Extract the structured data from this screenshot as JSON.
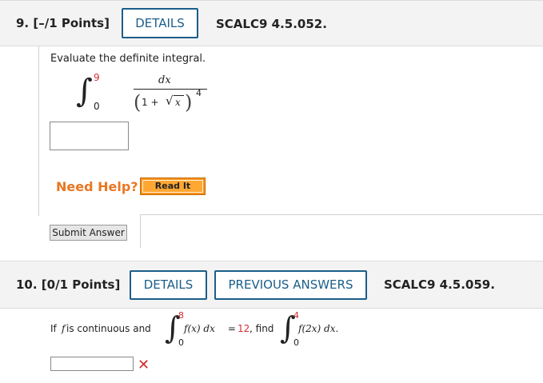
{
  "q9": {
    "points": "9.  [–/1 Points]",
    "details_label": "DETAILS",
    "code": "SCALC9 4.5.052.",
    "prompt": "Evaluate the definite integral.",
    "integral": {
      "upper": "9",
      "lower": "0",
      "numerator": "dx",
      "denominator_one": "1 + ",
      "denominator_x": "x",
      "exponent": "4"
    },
    "answer_value": "",
    "need_help": "Need Help?",
    "read_it_label": "Read It",
    "submit_label": "Submit Answer"
  },
  "q10": {
    "points": "10.  [0/1 Points]",
    "details_label": "DETAILS",
    "previous_answers_label": "PREVIOUS ANSWERS",
    "code": "SCALC9 4.5.059.",
    "prompt_prefix": "If ",
    "prompt_f": "f",
    "prompt_mid": " is continuous and",
    "int1_upper": "8",
    "int1_lower": "0",
    "int1_expr": "f(x) dx",
    "equals": " = ",
    "value": "12",
    "find": ", find",
    "int2_upper": "4",
    "int2_lower": "0",
    "int2_expr": "f(2x) dx.",
    "answer_value": "",
    "status_icon": "incorrect-x-icon",
    "status_color": "#d32f2f"
  },
  "colors": {
    "header_bg": "#f3f3f3",
    "accent_blue": "#1b5e8a",
    "help_orange": "#e87722",
    "read_it_bg": "#f7941d",
    "error_red": "#d32f2f"
  }
}
